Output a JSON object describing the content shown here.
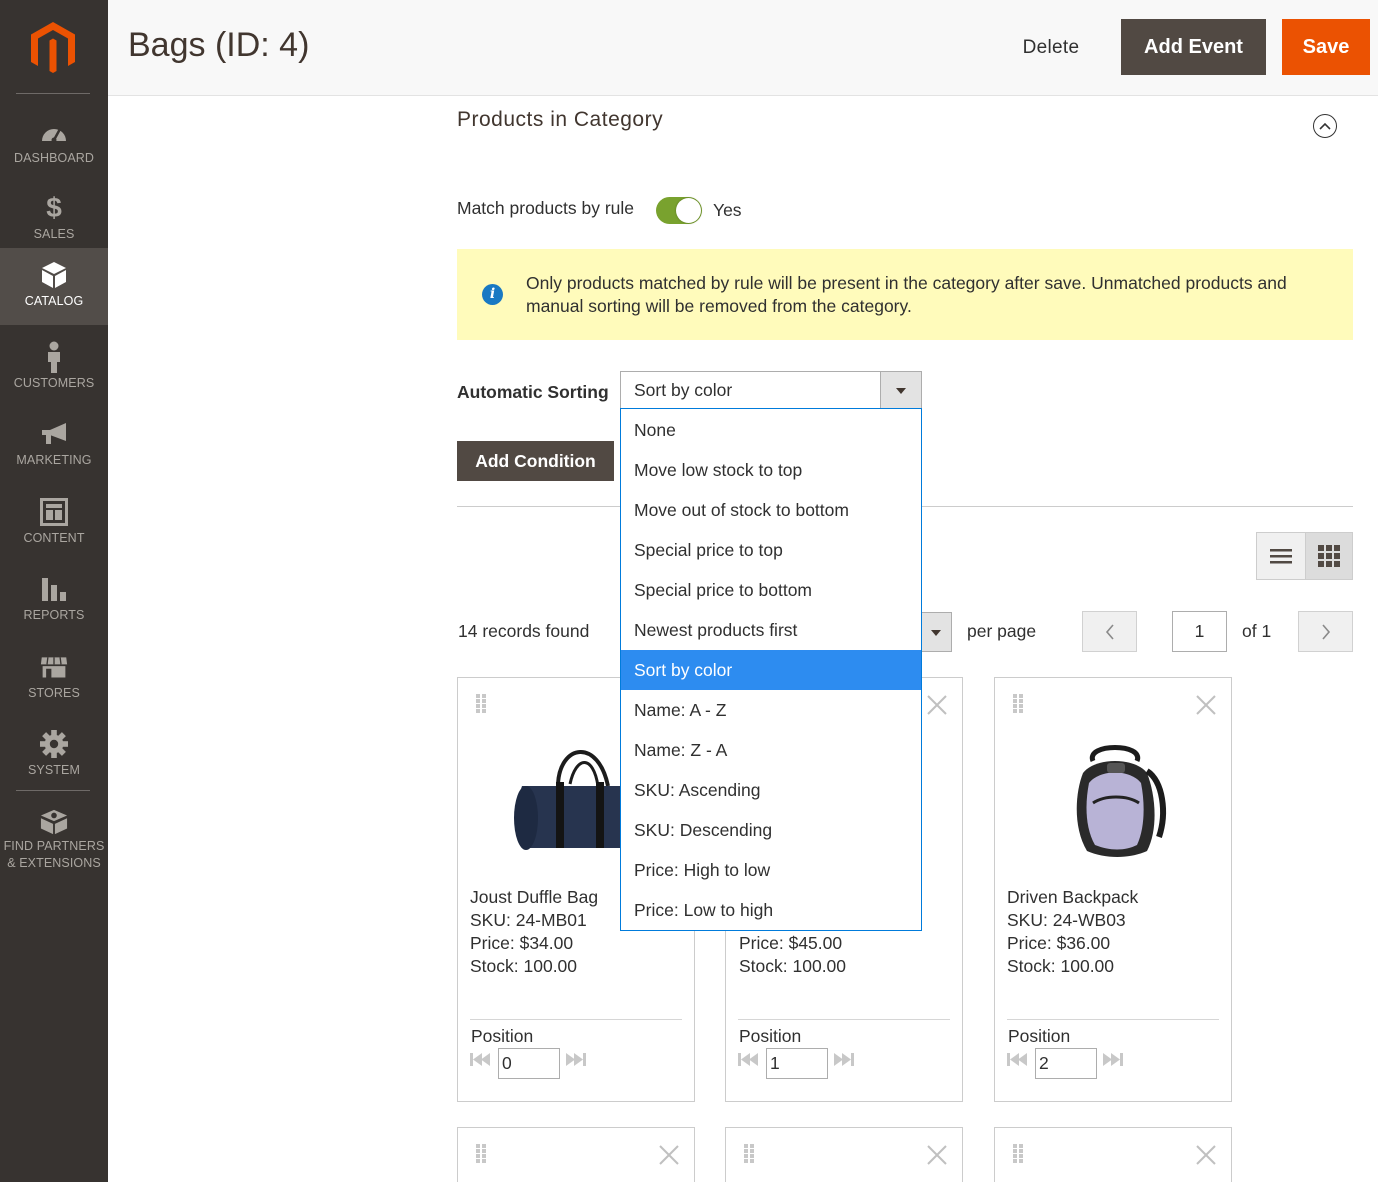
{
  "sidebar": {
    "items": [
      {
        "label": "DASHBOARD",
        "icon": "dashboard-icon"
      },
      {
        "label": "SALES",
        "icon": "dollar-icon"
      },
      {
        "label": "CATALOG",
        "icon": "catalog-box-icon",
        "active": true
      },
      {
        "label": "CUSTOMERS",
        "icon": "customer-icon"
      },
      {
        "label": "MARKETING",
        "icon": "megaphone-icon"
      },
      {
        "label": "CONTENT",
        "icon": "content-layout-icon"
      },
      {
        "label": "REPORTS",
        "icon": "bar-chart-icon"
      },
      {
        "label": "STORES",
        "icon": "store-icon"
      },
      {
        "label": "SYSTEM",
        "icon": "gear-icon"
      },
      {
        "label_line1": "FIND PARTNERS",
        "label_line2": "& EXTENSIONS",
        "icon": "extensions-icon"
      }
    ]
  },
  "header": {
    "title": "Bags (ID: 4)",
    "delete_label": "Delete",
    "add_event_label": "Add Event",
    "save_label": "Save"
  },
  "section": {
    "title": "Products in Category",
    "match_label": "Match products by rule",
    "match_value": "Yes",
    "notice": "Only products matched by rule will be present in the category after save. Unmatched products and manual sorting will be removed from the category.",
    "sorting_label": "Automatic Sorting",
    "sorting_value": "Sort by color",
    "sorting_options": [
      "None",
      "Move low stock to top",
      "Move out of stock to bottom",
      "Special price to top",
      "Special price to bottom",
      "Newest products first",
      "Sort by color",
      "Name: A - Z",
      "Name: Z - A",
      "SKU: Ascending",
      "SKU: Descending",
      "Price: High to low",
      "Price: Low to high"
    ],
    "add_condition_label": "Add Condition"
  },
  "grid": {
    "records": "14 records found",
    "per_page": "per page",
    "page": "1",
    "of": "of 1"
  },
  "products": [
    {
      "name": "Joust Duffle Bag",
      "sku": "SKU: 24-MB01",
      "price": "Price: $34.00",
      "stock": "Stock: 100.00",
      "position_label": "Position",
      "position": "0"
    },
    {
      "name": "",
      "sku": "",
      "price": "Price: $45.00",
      "stock": "Stock: 100.00",
      "position_label": "Position",
      "position": "1"
    },
    {
      "name": "Driven Backpack",
      "sku": "SKU: 24-WB03",
      "price": "Price: $36.00",
      "stock": "Stock: 100.00",
      "position_label": "Position",
      "position": "2"
    }
  ],
  "colors": {
    "sidebar_bg": "#373330",
    "accent": "#eb5202",
    "toggle_on": "#79a22e",
    "selected_option": "#2d8cf0",
    "notice_bg": "#fffbbb"
  }
}
